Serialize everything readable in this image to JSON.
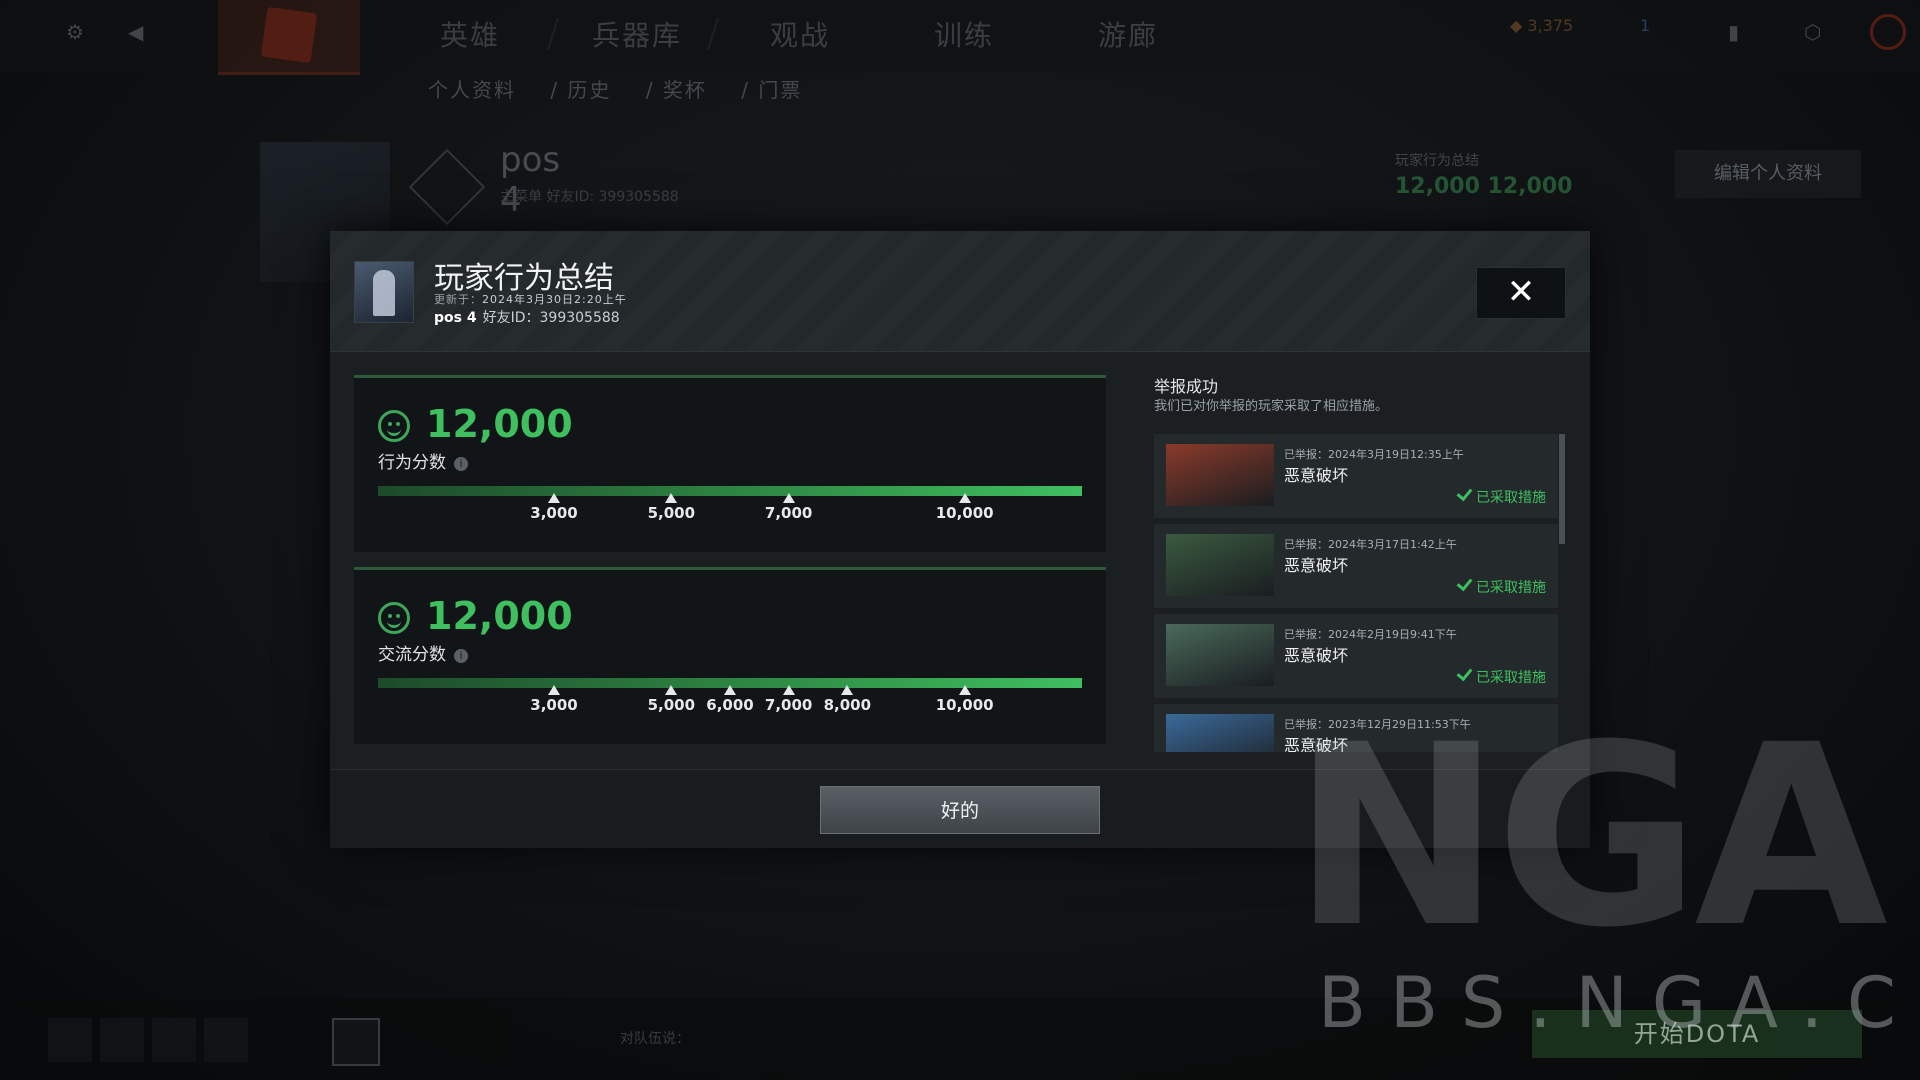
{
  "topnav": {
    "tabs": [
      "英雄",
      "兵器库",
      "观战",
      "训练",
      "游廊"
    ],
    "shards": "3,375",
    "notify_count": "1"
  },
  "subnav": [
    "个人资料",
    "/ 历史",
    "/ 奖杯",
    "/ 门票"
  ],
  "profile_bg": {
    "name": "pos 4",
    "sub": "主菜单   好友ID: 399305588",
    "score_caption": "玩家行为总结",
    "score_vals": "12,000   12,000",
    "edit_label": "编辑个人资料"
  },
  "modal": {
    "title": "玩家行为总结",
    "updated_prefix": "更新于：",
    "updated_time": "2024年3月30日2:20上午",
    "player_name": "pos 4",
    "friend_id": "好友ID：399305588",
    "close_label": "✕",
    "ok_label": "好的"
  },
  "scores": [
    {
      "value": "12,000",
      "label": "行为分数",
      "fill_fraction": 1.0,
      "ticks": [
        "3,000",
        "5,000",
        "7,000",
        "10,000"
      ],
      "tick_values": [
        3000,
        5000,
        7000,
        10000
      ]
    },
    {
      "value": "12,000",
      "label": "交流分数",
      "fill_fraction": 1.0,
      "ticks": [
        "3,000",
        "5,000",
        "6,000",
        "7,000",
        "8,000",
        "10,000"
      ],
      "tick_values": [
        3000,
        5000,
        6000,
        7000,
        8000,
        10000
      ]
    }
  ],
  "reports": {
    "title": "举报成功",
    "subtitle": "我们已对你举报的玩家采取了相应措施。",
    "items": [
      {
        "date": "已举报：2024年3月19日12:35上午",
        "reason": "恶意破坏",
        "status": "已采取措施",
        "hero_color": "#8a3a2a"
      },
      {
        "date": "已举报：2024年3月17日1:42上午",
        "reason": "恶意破坏",
        "status": "已采取措施",
        "hero_color": "#3a5a40"
      },
      {
        "date": "已举报：2024年2月19日9:41下午",
        "reason": "恶意破坏",
        "status": "已采取措施",
        "hero_color": "#4a6a5a"
      },
      {
        "date": "已举报：2023年12月29日11:53下午",
        "reason": "恶意破坏",
        "status": "",
        "hero_color": "#3a6a9a"
      }
    ]
  },
  "bottombar": {
    "chat_hint": "对队伍说：",
    "play_label": "开始DOTA"
  },
  "watermark": {
    "logo": "NGA",
    "url": "BBS.NGA.CN"
  },
  "colors": {
    "accent_green": "#3fbf5f",
    "modal_bg": "#1b1f22"
  }
}
